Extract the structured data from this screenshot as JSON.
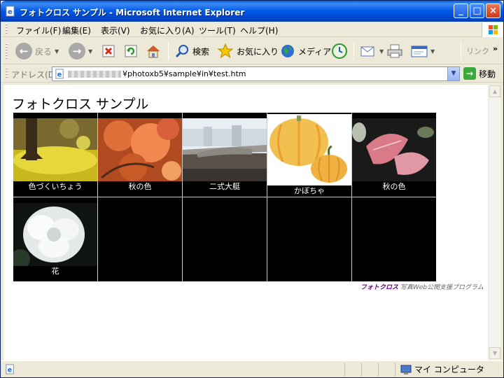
{
  "window": {
    "title": "フォトクロス サンプル - Microsoft Internet Explorer"
  },
  "menubar": {
    "items": [
      "ファイル(F)",
      "編集(E)",
      "表示(V)",
      "お気に入り(A)",
      "ツール(T)",
      "ヘルプ(H)"
    ]
  },
  "toolbar": {
    "back_label": "戻る",
    "search_label": "検索",
    "favorites_label": "お気に入り",
    "media_label": "メディア",
    "links_label": "リンク"
  },
  "address": {
    "label": "アドレス(D)",
    "url_tail": "¥photoxb5¥sample¥in¥test.htm",
    "go_label": "移動"
  },
  "page": {
    "title": "フォトクロス サンプル",
    "photos": [
      {
        "caption": "色づくいちょう"
      },
      {
        "caption": "秋の色"
      },
      {
        "caption": "二式大艇"
      },
      {
        "caption": "かぼちゃ"
      },
      {
        "caption": "秋の色"
      },
      {
        "caption": "花"
      }
    ],
    "footer_brand": "フォトクロス",
    "footer_desc": "写真Web公開支援プログラム"
  },
  "status": {
    "zone": "マイ コンピュータ"
  },
  "colors": {
    "titlebar": "#0058e6",
    "footer_brand": "#6a0080"
  }
}
